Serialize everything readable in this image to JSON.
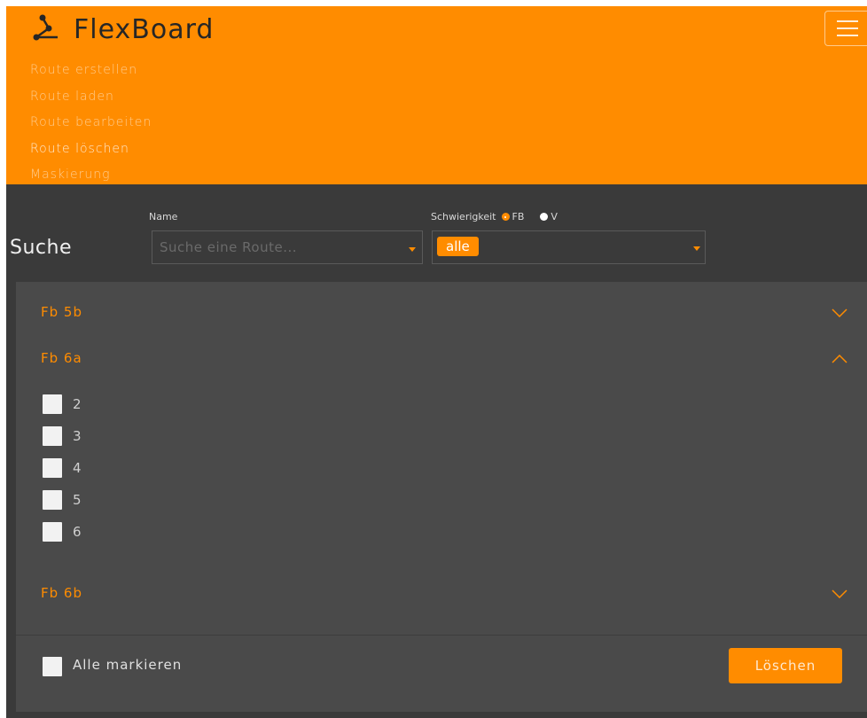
{
  "app": {
    "brand": "FlexBoard",
    "accent_color": "#ff8c00",
    "menu_icon": "hamburger-icon",
    "brand_icon": "route-nodes-icon"
  },
  "nav": {
    "items": [
      {
        "label": "Route erstellen"
      },
      {
        "label": "Route laden"
      },
      {
        "label": "Route bearbeiten"
      },
      {
        "label": "Route löschen",
        "active": true
      },
      {
        "label": "Maskierung"
      }
    ]
  },
  "search": {
    "title": "Suche",
    "name_label": "Name",
    "name_placeholder": "Suche eine Route...",
    "difficulty_label": "Schwierigkeit",
    "difficulty_options": [
      {
        "label": "FB",
        "selected": true
      },
      {
        "label": "V",
        "selected": false
      }
    ],
    "difficulty_value": "alle"
  },
  "groups": [
    {
      "title": "Fb 5b",
      "expanded": false,
      "chevron": "chevron-down-icon"
    },
    {
      "title": "Fb 6a",
      "expanded": true,
      "chevron": "chevron-up-icon",
      "routes": [
        "2",
        "3",
        "4",
        "5",
        "6"
      ]
    },
    {
      "title": "Fb 6b",
      "expanded": false,
      "chevron": "chevron-down-icon"
    }
  ],
  "footer": {
    "select_all_label": "Alle markieren",
    "delete_label": "Löschen"
  }
}
